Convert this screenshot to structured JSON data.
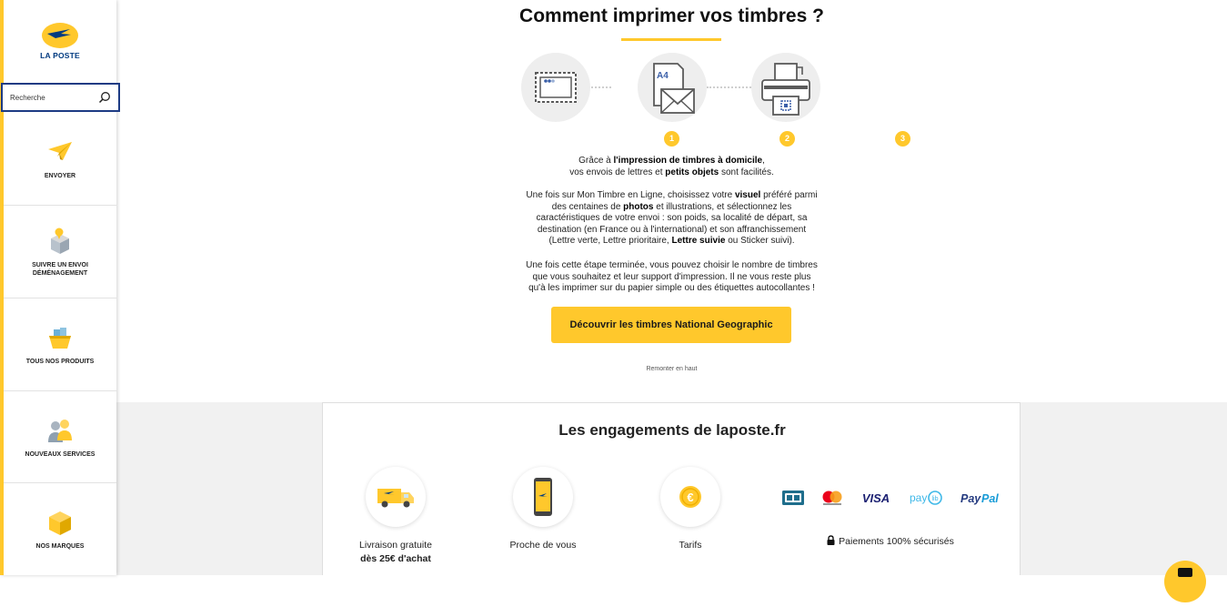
{
  "sidebar": {
    "logo_text": "LA POSTE",
    "search_value": "Recherche",
    "items": [
      {
        "label": "ENVOYER",
        "icon": "paper-plane-icon"
      },
      {
        "label": "SUIVRE UN ENVOI DÉMÉNAGEMENT",
        "icon": "package-track-icon"
      },
      {
        "label": "TOUS NOS PRODUITS",
        "icon": "basket-icon"
      },
      {
        "label": "NOUVEAUX SERVICES",
        "icon": "people-icon"
      },
      {
        "label": "NOS MARQUES",
        "icon": "box-icon"
      }
    ]
  },
  "main": {
    "title": "Comment imprimer vos timbres ?",
    "steps": [
      {
        "number": "1",
        "icon": "stamp-icon"
      },
      {
        "number": "2",
        "icon": "a4-envelope-icon"
      },
      {
        "number": "3",
        "icon": "printer-icon"
      }
    ],
    "step_a4_label": "A4",
    "para1": {
      "l1_a": "Grâce à ",
      "l1_b": "l'impression de timbres à domicile",
      "l1_c": ",",
      "l2_a": "vos envois de lettres et ",
      "l2_b": "petits objets",
      "l2_c": " sont facilités."
    },
    "para2": {
      "l1_a": "Une fois sur Mon Timbre en Ligne, choisissez votre ",
      "l1_b": "visuel",
      "l1_c": " préféré parmi",
      "l2_a": "des centaines de ",
      "l2_b": "photos",
      "l2_c": " et illustrations, et sélectionnez les",
      "l3": "caractéristiques de votre envoi : son poids, sa localité de départ, sa",
      "l4": "destination (en France ou à l'international) et son affranchissement",
      "l5_a": "(Lettre verte, Lettre prioritaire, ",
      "l5_b": "Lettre suivie",
      "l5_c": " ou Sticker suivi)."
    },
    "para3": {
      "l1": "Une fois cette étape terminée, vous pouvez choisir le nombre de timbres",
      "l2": "que vous souhaitez et leur support d'impression. Il ne vous reste plus",
      "l3": "qu'à les imprimer sur du papier simple ou des étiquettes autocollantes !"
    },
    "cta_label": "Découvrir les timbres National Geographic",
    "back_to_top": "Remonter en haut"
  },
  "engagements": {
    "title": "Les engagements de laposte.fr",
    "items": [
      {
        "label": "Livraison gratuite",
        "bold": "dès 25€ d'achat",
        "icon": "delivery-truck-icon"
      },
      {
        "label": "Proche de vous",
        "bold": "",
        "icon": "smartphone-icon"
      },
      {
        "label": "Tarifs",
        "bold": "",
        "icon": "euro-coin-icon"
      }
    ],
    "payments": [
      "CB",
      "mastercard",
      "VISA",
      "paylib",
      "PayPal"
    ],
    "secure_label": "Paiements 100% sécurisés"
  },
  "colors": {
    "brand_yellow": "#ffc82c",
    "brand_blue": "#003a80",
    "search_border": "#1d3b84"
  }
}
